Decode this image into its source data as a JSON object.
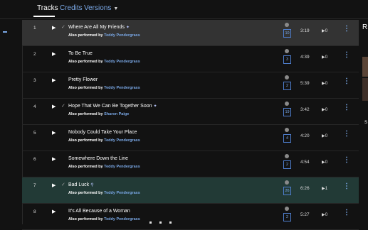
{
  "tabs": [
    {
      "label": "Tracks",
      "active": true
    },
    {
      "label": "Credits",
      "active": false
    },
    {
      "label": "Versions",
      "active": false
    }
  ],
  "colors": {
    "accent": "#7aa8e6",
    "selected_row": "#333333",
    "highlighted_row": "#223a36"
  },
  "icons": {
    "play": "▶",
    "check": "✓",
    "menu": "⋮",
    "stats": "badge-icon"
  },
  "tracks": [
    {
      "num": "1",
      "title": "Where Are All My Friends",
      "title_icon": "sparkle-icon",
      "by_label": "Also performed by",
      "artist": "Teddy Pendergrass",
      "count": "10",
      "duration": "3:19",
      "plays": "0",
      "checked": true,
      "state": "selected"
    },
    {
      "num": "2",
      "title": "To Be True",
      "title_icon": "",
      "by_label": "Also performed by",
      "artist": "Teddy Pendergrass",
      "count": "3",
      "duration": "4:39",
      "plays": "0",
      "checked": false,
      "state": ""
    },
    {
      "num": "3",
      "title": "Pretty Flower",
      "title_icon": "",
      "by_label": "Also performed by",
      "artist": "Teddy Pendergrass",
      "count": "2",
      "duration": "5:39",
      "plays": "0",
      "checked": false,
      "state": ""
    },
    {
      "num": "4",
      "title": "Hope That We Can Be Together Soon",
      "title_icon": "sparkle-icon",
      "by_label": "Also performed by",
      "artist": "Sharon Paige",
      "count": "19",
      "duration": "3:42",
      "plays": "0",
      "checked": true,
      "state": ""
    },
    {
      "num": "5",
      "title": "Nobody Could Take Your Place",
      "title_icon": "",
      "by_label": "Also performed by",
      "artist": "Teddy Pendergrass",
      "count": "4",
      "duration": "4:20",
      "plays": "0",
      "checked": false,
      "state": ""
    },
    {
      "num": "6",
      "title": "Somewhere Down the Line",
      "title_icon": "",
      "by_label": "Also performed by",
      "artist": "Teddy Pendergrass",
      "count": "2",
      "duration": "4:54",
      "plays": "0",
      "checked": false,
      "state": ""
    },
    {
      "num": "7",
      "title": "Bad Luck",
      "title_icon": "link-icon",
      "by_label": "Also performed by",
      "artist": "Teddy Pendergrass",
      "count": "26",
      "duration": "6:26",
      "plays": "1",
      "checked": true,
      "state": "highlighted"
    },
    {
      "num": "8",
      "title": "It's All Because of a Woman",
      "title_icon": "",
      "by_label": "Also performed by",
      "artist": "Teddy Pendergrass",
      "count": "2",
      "duration": "5:27",
      "plays": "0",
      "checked": false,
      "state": ""
    }
  ],
  "right_panel": {
    "heading_initial": "R",
    "caption_initial": "S"
  }
}
